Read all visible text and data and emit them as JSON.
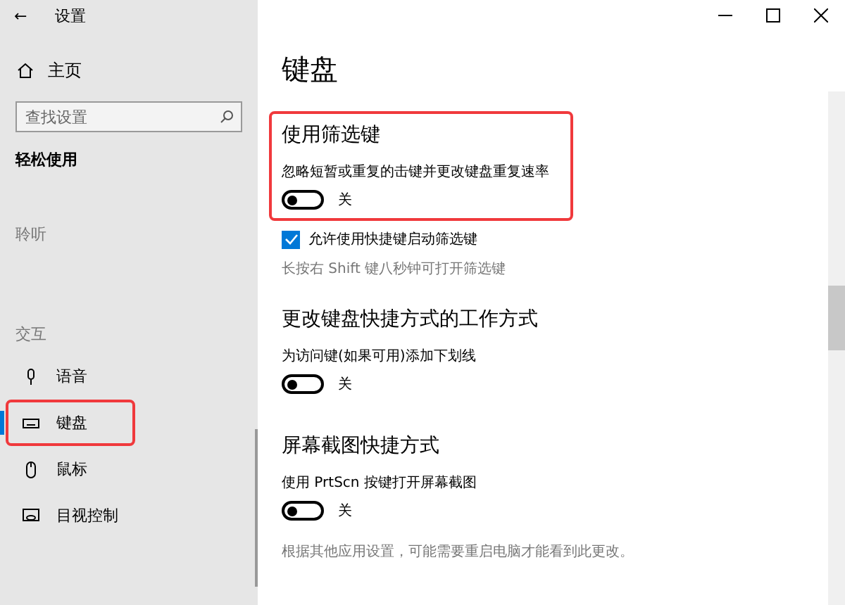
{
  "window": {
    "title": "设置",
    "back": "←"
  },
  "sidebar": {
    "home": "主页",
    "search": {
      "placeholder": "查找设置"
    },
    "category": "轻松使用",
    "groups": [
      {
        "label": "聆听"
      },
      {
        "label": "交互",
        "items": [
          {
            "label": "语音",
            "kind": "mic",
            "selected": false,
            "highlighted": false
          },
          {
            "label": "键盘",
            "kind": "keyboard",
            "selected": true,
            "highlighted": true
          },
          {
            "label": "鼠标",
            "kind": "mouse",
            "selected": false,
            "highlighted": false
          },
          {
            "label": "目视控制",
            "kind": "eye",
            "selected": false,
            "highlighted": false
          }
        ]
      }
    ]
  },
  "page": {
    "title": "键盘",
    "sections": [
      {
        "title": "使用筛选键",
        "highlighted": true,
        "settings": [
          {
            "kind": "toggle",
            "label": "忽略短暂或重复的击键并更改键盘重复速率",
            "on": false,
            "state": "关"
          },
          {
            "kind": "checkbox",
            "label": "允许使用快捷键启动筛选键",
            "checked": true
          },
          {
            "kind": "note",
            "label": "长按右 Shift 键八秒钟可打开筛选键"
          }
        ]
      },
      {
        "title": "更改键盘快捷方式的工作方式",
        "highlighted": false,
        "settings": [
          {
            "kind": "toggle",
            "label": "为访问键(如果可用)添加下划线",
            "on": false,
            "state": "关"
          }
        ]
      },
      {
        "title": "屏幕截图快捷方式",
        "highlighted": false,
        "settings": [
          {
            "kind": "toggle",
            "label": "使用 PrtScn 按键打开屏幕截图",
            "on": false,
            "state": "关"
          },
          {
            "kind": "note",
            "label": "根据其他应用设置，可能需要重启电脑才能看到此更改。"
          }
        ]
      }
    ]
  }
}
